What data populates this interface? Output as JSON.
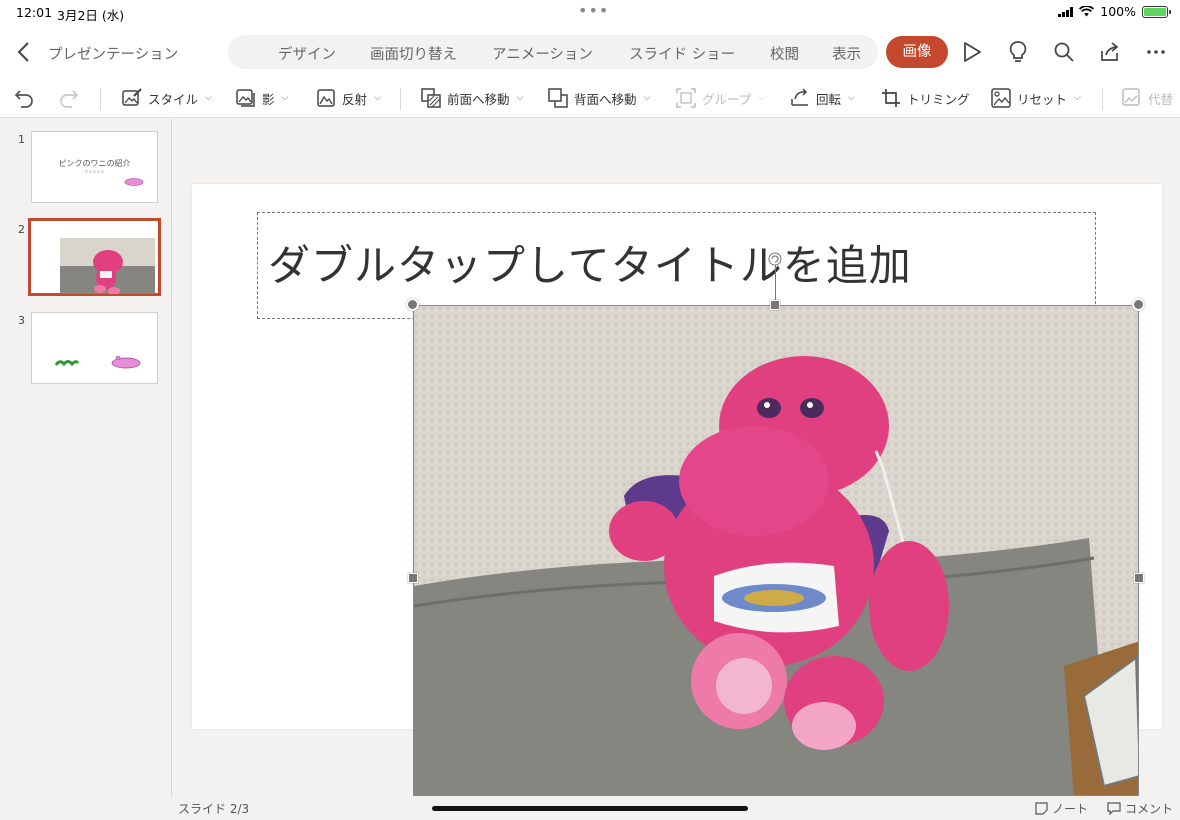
{
  "status": {
    "time": "12:01",
    "date": "3月2日 (水)",
    "battery": "100%",
    "battery_level": 1.0
  },
  "header": {
    "doc_title": "プレゼンテーション",
    "tabs": [
      "デザイン",
      "画面切り替え",
      "アニメーション",
      "スライド ショー",
      "校閲",
      "表示"
    ],
    "active_tab": "画像",
    "icons": [
      "play-icon",
      "lightbulb-icon",
      "search-icon",
      "share-icon",
      "more-icon"
    ]
  },
  "ribbon": {
    "style": "スタイル",
    "shadow": "影",
    "reflection": "反射",
    "bring_forward": "前面へ移動",
    "send_backward": "背面へ移動",
    "group": "グループ",
    "rotate": "回転",
    "crop": "トリミング",
    "reset": "リセット",
    "alt_text": "代替"
  },
  "thumbnails": [
    {
      "num": "1",
      "title": "ピンクのワニの紹介",
      "subtitle": "ＸＸＸＸＸ"
    },
    {
      "num": "2"
    },
    {
      "num": "3"
    }
  ],
  "slide": {
    "title_placeholder": "ダブルタップしてタイトルを追加"
  },
  "footer": {
    "slide_count": "スライド 2/3",
    "notes": "ノート",
    "comments": "コメント"
  },
  "colors": {
    "accent": "#c4482d",
    "plush": "#e0407f",
    "pillow": "#858680",
    "wall": "#d9d4cc"
  }
}
